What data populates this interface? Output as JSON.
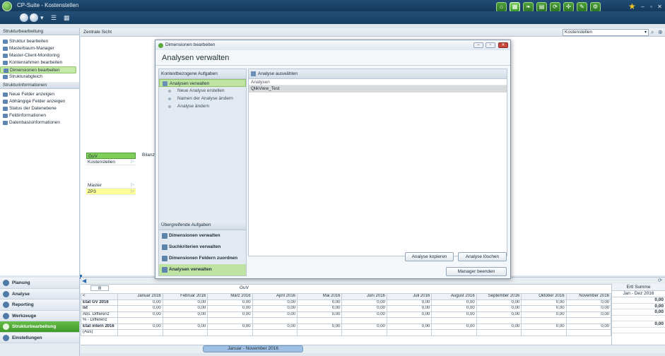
{
  "window": {
    "title": "CP-Suite - Kostenstellen"
  },
  "colors": {
    "titlebar": "#1f4d76",
    "accent_green": "#4da13a",
    "selection_green": "#c6e8a9",
    "highlight_yellow": "#ffff99"
  },
  "toolbar_icons": [
    "home-icon",
    "tree-icon",
    "leaf-icon",
    "book-icon",
    "refresh-icon",
    "network-icon",
    "edit-icon",
    "gear-icon"
  ],
  "left_panel": {
    "header": "Strukturbearbeitung",
    "items": [
      {
        "label": "Struktur bearbeiten",
        "icon": "structure-icon"
      },
      {
        "label": "Masterbaum-Manager",
        "icon": "tree-icon"
      },
      {
        "label": "Master-Client-Monitoring",
        "icon": "monitor-icon"
      },
      {
        "label": "Kontenrahmen bearbeiten",
        "icon": "accounts-icon"
      },
      {
        "label": "Dimensionen bearbeiten",
        "icon": "dimension-icon",
        "selected": true
      },
      {
        "label": "Strukturabgleich",
        "icon": "compare-icon"
      }
    ],
    "info_header": "Strukturinformationen",
    "info_items": [
      {
        "label": "Neue Felder anzeigen",
        "icon": "new-fields-icon"
      },
      {
        "label": "Abhängige Felder anzeigen",
        "icon": "dependency-icon"
      },
      {
        "label": "Status der Datenebene",
        "icon": "status-icon"
      },
      {
        "label": "Feldinformationen",
        "icon": "info-icon"
      },
      {
        "label": "Datenbasisinformationen",
        "icon": "database-icon"
      }
    ]
  },
  "bottom_nav": [
    {
      "label": "Planung",
      "icon": "planning-icon"
    },
    {
      "label": "Analyse",
      "icon": "analysis-icon"
    },
    {
      "label": "Reporting",
      "icon": "reporting-icon"
    },
    {
      "label": "Werkzeuge",
      "icon": "tools-icon"
    },
    {
      "label": "Strukturbearbeitung",
      "icon": "structure-edit-icon",
      "active": true
    },
    {
      "label": "Einstellungen",
      "icon": "settings-icon"
    }
  ],
  "central": {
    "header": "Zentrale Sicht",
    "combo_value": "Kostenstellen",
    "tree": [
      {
        "label": "GuV",
        "style": "green"
      },
      {
        "label": "Kostenstellen",
        "style": "plain"
      },
      {
        "label": "Master",
        "style": "plain"
      },
      {
        "label": "ZP3",
        "style": "yellow"
      }
    ],
    "bilanz_label": "Bilanz"
  },
  "dialog": {
    "title": "Dimensionen bearbeiten",
    "heading": "Analysen verwalten",
    "task_header": "Kontextbezogene Aufgaben",
    "task_main": "Analysen verwalten",
    "task_subs": [
      "Neue Analyse erstellen",
      "Namen der Analyse ändern",
      "Analyse ändern"
    ],
    "global_header": "Übergreifende Aufgaben",
    "global_items": [
      {
        "label": "Dimensionen verwalten",
        "icon": "dimension-icon"
      },
      {
        "label": "Suchkriterien verwalten",
        "icon": "search-criteria-icon"
      },
      {
        "label": "Dimensionen Feldern zuordnen",
        "icon": "assign-icon"
      },
      {
        "label": "Analysen verwalten",
        "icon": "analysis-icon",
        "selected": true
      }
    ],
    "select_header": "Analyse auswählen",
    "list_header": "Analysen",
    "list_items": [
      "QlikView_Test"
    ],
    "buttons": {
      "copy": "Analyse kopieren",
      "delete": "Analyse löschen",
      "close": "Manager beenden"
    }
  },
  "grid": {
    "filter_label": "GuV",
    "months": [
      "Januar 2016",
      "Februar 2016",
      "März 2016",
      "April 2016",
      "Mai 2016",
      "Juni 2016",
      "Juli 2016",
      "August 2016",
      "September 2016",
      "Oktober 2016",
      "November 2016"
    ],
    "rows": [
      {
        "label": "Etat GV 2016",
        "values": [
          "0,00",
          "0,00",
          "0,00",
          "0,00",
          "0,00",
          "0,00",
          "0,00",
          "0,00",
          "0,00",
          "0,00",
          "0,00"
        ],
        "sum": "0,00"
      },
      {
        "label": "Ist",
        "values": [
          "0,00",
          "0,00",
          "0,00",
          "0,00",
          "0,00",
          "0,00",
          "0,00",
          "0,00",
          "0,00",
          "0,00",
          "0,00"
        ],
        "sum": "0,00"
      },
      {
        "label": "Abs. Differenz",
        "values": [
          "0,00",
          "0,00",
          "0,00",
          "0,00",
          "0,00",
          "0,00",
          "0,00",
          "0,00",
          "0,00",
          "0,00",
          "0,00"
        ],
        "sum": "0,00"
      },
      {
        "label": "% - Differenz",
        "values": [
          "",
          "",
          "",
          "",
          "",
          "",
          "",
          "",
          "",
          "",
          ""
        ],
        "sum": ""
      },
      {
        "label": "Etat intern 2016",
        "values": [
          "0,00",
          "0,00",
          "0,00",
          "0,00",
          "0,00",
          "0,00",
          "0,00",
          "0,00",
          "0,00",
          "0,00",
          "0,00"
        ],
        "sum": "0,00"
      },
      {
        "label": "(Aus)",
        "values": [
          "",
          "",
          "",
          "",
          "",
          "",
          "",
          "",
          "",
          "",
          ""
        ],
        "sum": ""
      }
    ],
    "sum_header": "Ertl Summe",
    "sum_period": "Jan - Dez 2016",
    "period_label": "Januar - November 2016"
  }
}
